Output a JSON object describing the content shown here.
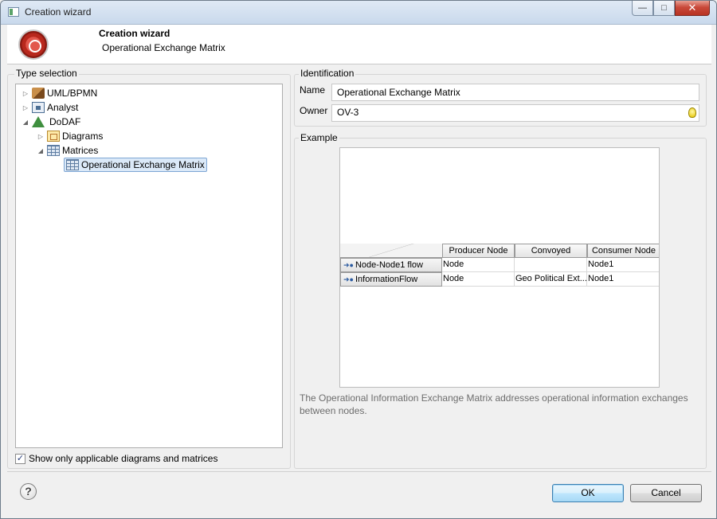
{
  "window": {
    "title": "Creation wizard"
  },
  "banner": {
    "title": "Creation wizard",
    "subtitle": "Operational Exchange Matrix"
  },
  "type_selection": {
    "label": "Type selection",
    "tree": [
      {
        "label": "UML/BPMN",
        "icon": "uml-package-icon",
        "expanded": false
      },
      {
        "label": "Analyst",
        "icon": "analyst-icon",
        "expanded": false
      },
      {
        "label": "DoDAF",
        "icon": "dodaf-icon",
        "expanded": true
      },
      {
        "label": "Diagrams",
        "icon": "diagrams-icon",
        "expanded": false
      },
      {
        "label": "Matrices",
        "icon": "matrices-icon",
        "expanded": true
      },
      {
        "label": "Operational Exchange Matrix",
        "icon": "matrix-icon",
        "selected": true
      }
    ],
    "checkbox": {
      "label": "Show only applicable diagrams and matrices",
      "checked": true
    }
  },
  "identification": {
    "label": "Identification",
    "name_label": "Name",
    "name_value": "Operational Exchange Matrix",
    "owner_label": "Owner",
    "owner_value": "OV-3"
  },
  "example": {
    "label": "Example",
    "matrix": {
      "columns": [
        "Producer Node",
        "Convoyed",
        "Consumer Node"
      ],
      "rows": [
        {
          "header": "Node-Node1 flow",
          "cells": [
            "Node",
            "",
            "Node1"
          ]
        },
        {
          "header": "InformationFlow",
          "cells": [
            "Node",
            "Geo Political Ext...",
            "Node1"
          ]
        }
      ]
    },
    "description": "The Operational Information Exchange Matrix addresses operational information exchanges between nodes."
  },
  "buttons": {
    "ok": "OK",
    "cancel": "Cancel",
    "help": "?"
  },
  "colors": {
    "selection": "#dbe9f8",
    "default_button": "#bee6fd",
    "logo": "#c0392b"
  }
}
